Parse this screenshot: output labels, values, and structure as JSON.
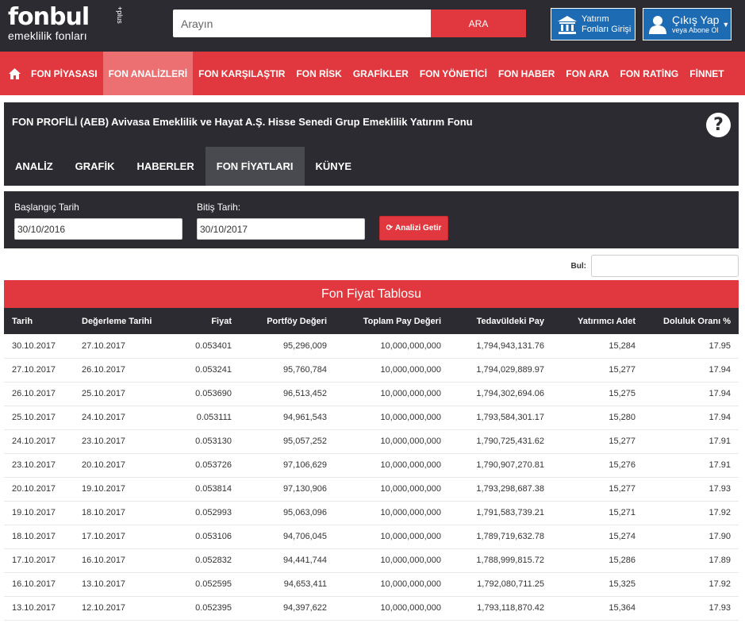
{
  "header": {
    "brand": "fonbul",
    "brand_plus": "+plus",
    "brand_sub": "emeklilik fonları",
    "search_placeholder": "Arayın",
    "search_button": "ARA",
    "invest_button_line1": "Yatırım",
    "invest_button_line2": "Fonları Girişi",
    "account_line1": "Çıkış Yap",
    "account_line2": "veya Abone Ol"
  },
  "nav": {
    "home_icon": "home-icon",
    "items": [
      "FON PİYASASI",
      "FON ANALİZLERİ",
      "FON KARŞILAŞTIR",
      "FON RİSK",
      "GRAFİKLER",
      "FON YÖNETİCİ",
      "FON HABER",
      "FON ARA",
      "FON RATİNG",
      "FİNNET"
    ],
    "active_index": 1
  },
  "profile": {
    "title": "FON PROFİLİ (AEB) Avivasa Emeklilik ve Hayat A.Ş. Hisse Senedi Grup Emeklilik Yatırım Fonu",
    "help": "?",
    "tabs": [
      "ANALİZ",
      "GRAFİK",
      "HABERLER",
      "FON FİYATLARI",
      "KÜNYE"
    ],
    "active_tab": 3
  },
  "dates": {
    "start_label": "Başlangıç Tarih",
    "start_value": "30/10/2016",
    "end_label": "Bitiş Tarih:",
    "end_value": "30/10/2017",
    "button": "Analizi Getir"
  },
  "find": {
    "label": "Bul:",
    "value": ""
  },
  "table": {
    "title": "Fon Fiyat Tablosu",
    "columns": [
      "Tarih",
      "Değerleme Tarihi",
      "Fiyat",
      "Portföy Değeri",
      "Toplam Pay Değeri",
      "Tedavüldeki Pay",
      "Yatırımcı Adet",
      "Doluluk Oranı %"
    ],
    "rows": [
      [
        "30.10.2017",
        "27.10.2017",
        "0.053401",
        "95,296,009",
        "10,000,000,000",
        "1,794,943,131.76",
        "15,284",
        "17.95"
      ],
      [
        "27.10.2017",
        "26.10.2017",
        "0.053241",
        "95,760,784",
        "10,000,000,000",
        "1,794,029,889.97",
        "15,277",
        "17.94"
      ],
      [
        "26.10.2017",
        "25.10.2017",
        "0.053690",
        "96,513,452",
        "10,000,000,000",
        "1,794,302,694.06",
        "15,275",
        "17.94"
      ],
      [
        "25.10.2017",
        "24.10.2017",
        "0.053111",
        "94,961,543",
        "10,000,000,000",
        "1,793,584,301.17",
        "15,280",
        "17.94"
      ],
      [
        "24.10.2017",
        "23.10.2017",
        "0.053130",
        "95,057,252",
        "10,000,000,000",
        "1,790,725,431.62",
        "15,277",
        "17.91"
      ],
      [
        "23.10.2017",
        "20.10.2017",
        "0.053726",
        "97,106,629",
        "10,000,000,000",
        "1,790,907,270.81",
        "15,276",
        "17.91"
      ],
      [
        "20.10.2017",
        "19.10.2017",
        "0.053814",
        "97,130,906",
        "10,000,000,000",
        "1,793,298,687.38",
        "15,277",
        "17.93"
      ],
      [
        "19.10.2017",
        "18.10.2017",
        "0.052993",
        "95,063,096",
        "10,000,000,000",
        "1,791,583,739.21",
        "15,271",
        "17.92"
      ],
      [
        "18.10.2017",
        "17.10.2017",
        "0.053106",
        "94,706,045",
        "10,000,000,000",
        "1,789,719,632.78",
        "15,274",
        "17.90"
      ],
      [
        "17.10.2017",
        "16.10.2017",
        "0.052832",
        "94,441,744",
        "10,000,000,000",
        "1,788,999,815.72",
        "15,286",
        "17.89"
      ],
      [
        "16.10.2017",
        "13.10.2017",
        "0.052595",
        "94,653,411",
        "10,000,000,000",
        "1,792,080,711.25",
        "15,325",
        "17.92"
      ],
      [
        "13.10.2017",
        "12.10.2017",
        "0.052395",
        "94,397,622",
        "10,000,000,000",
        "1,793,118,870.42",
        "15,364",
        "17.93"
      ]
    ]
  },
  "colors": {
    "accent": "#e0383e",
    "dark": "#2b2b31",
    "blue": "#1d6bb3"
  }
}
